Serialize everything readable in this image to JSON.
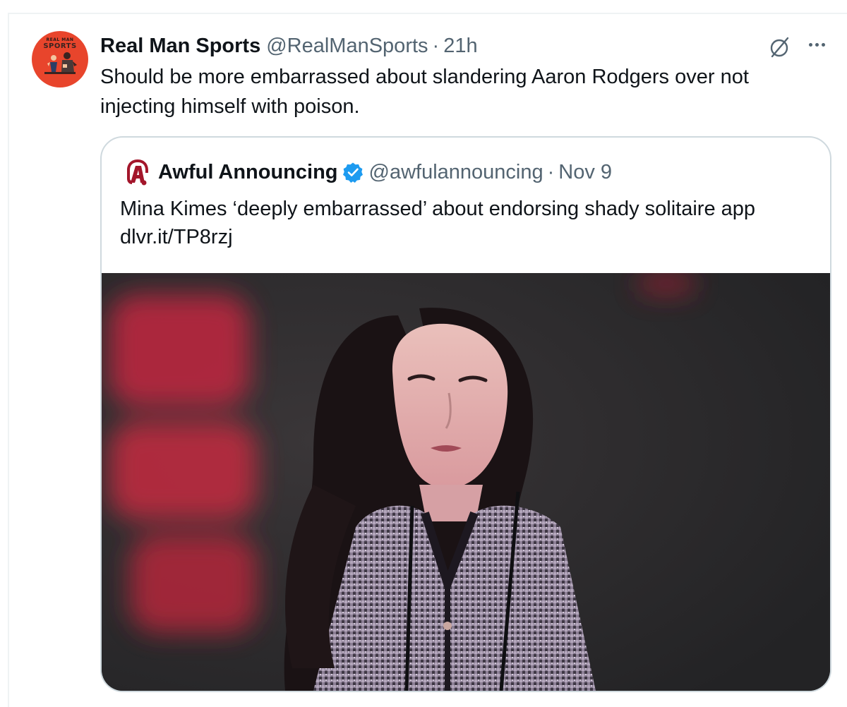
{
  "post": {
    "author_name": "Real Man Sports",
    "author_handle": "@RealManSports",
    "separator": "·",
    "time": "21h",
    "avatar_text_top": "REAL MAN",
    "avatar_text_bottom": "SPORTS",
    "text_line1": "Should be more embarrassed about slandering Aaron Rodgers over not",
    "text_line2": "injecting himself with poison."
  },
  "quoted_post": {
    "author_name": "Awful Announcing",
    "verified": true,
    "author_handle": "@awfulannouncing",
    "separator": "·",
    "date": "Nov 9",
    "text": "Mina Kimes ‘deeply embarrassed’ about endorsing shady solitaire app",
    "link": "dlvr.it/TP8rzj"
  },
  "icons": {
    "grok": "grok-icon",
    "more": "more-icon",
    "verified": "verified-badge-icon",
    "quote_logo": "awful-announcing-logo"
  },
  "colors": {
    "text_primary": "#0f1419",
    "text_secondary": "#536471",
    "border": "#cfd9de",
    "verified_blue": "#1d9bf0",
    "avatar_bg": "#e8452c",
    "logo_red": "#a3162b"
  }
}
